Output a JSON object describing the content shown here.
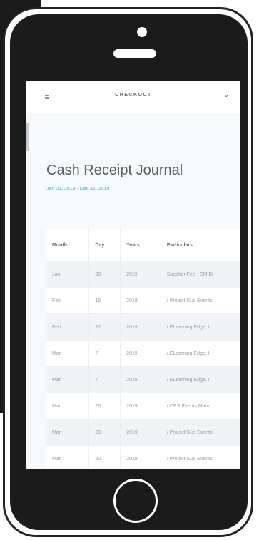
{
  "app": {
    "header_title": "CHECKOUT"
  },
  "page": {
    "title": "Cash Receipt Journal",
    "date_range": "Jan 01, 2019 - Dec 31, 2019"
  },
  "icons": {
    "menu": "hamburger-icon",
    "dropdown": "chevron-down-icon"
  },
  "colors": {
    "accent": "#42b9c9",
    "device": "#1b1b1b"
  },
  "table": {
    "columns": [
      "Month",
      "Day",
      "Years",
      "Particulars"
    ],
    "rows": [
      [
        "Jan",
        "30",
        "2019",
        "Speaker Fee - SM Bi"
      ],
      [
        "Feb",
        "16",
        "2019",
        "/ Project Gus Events"
      ],
      [
        "Feb",
        "22",
        "2019",
        "/ ELearning Edge, I"
      ],
      [
        "Mar",
        "7",
        "2019",
        "/ ELearning Edge, I"
      ],
      [
        "Mar",
        "7",
        "2019",
        "/ ELearning Edge, I"
      ],
      [
        "Mar",
        "20",
        "2019",
        "/ OPS Events Mana"
      ],
      [
        "Mar",
        "20",
        "2019",
        "/ Project Gus Events"
      ],
      [
        "Mar",
        "20",
        "2019",
        "/ Project Gus Events"
      ]
    ]
  }
}
